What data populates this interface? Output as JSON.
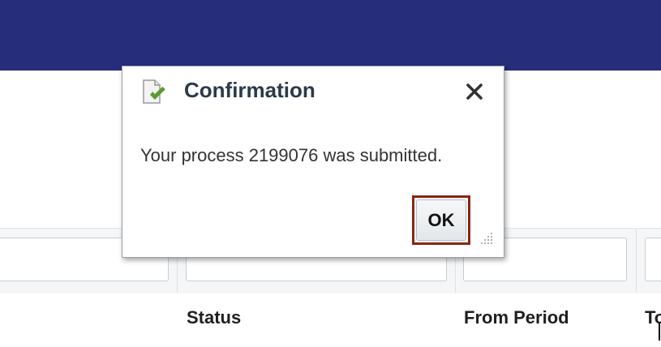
{
  "dialog": {
    "title": "Confirmation",
    "message": "Your process 2199076 was submitted.",
    "ok_label": "OK",
    "icon": "document-check-icon",
    "close_icon": "close-icon"
  },
  "table": {
    "columns": [
      "Status",
      "From Period",
      "To"
    ]
  },
  "colors": {
    "header_bar": "#262d7a",
    "ok_highlight": "#8b2412",
    "check_green": "#5e9b2f"
  }
}
